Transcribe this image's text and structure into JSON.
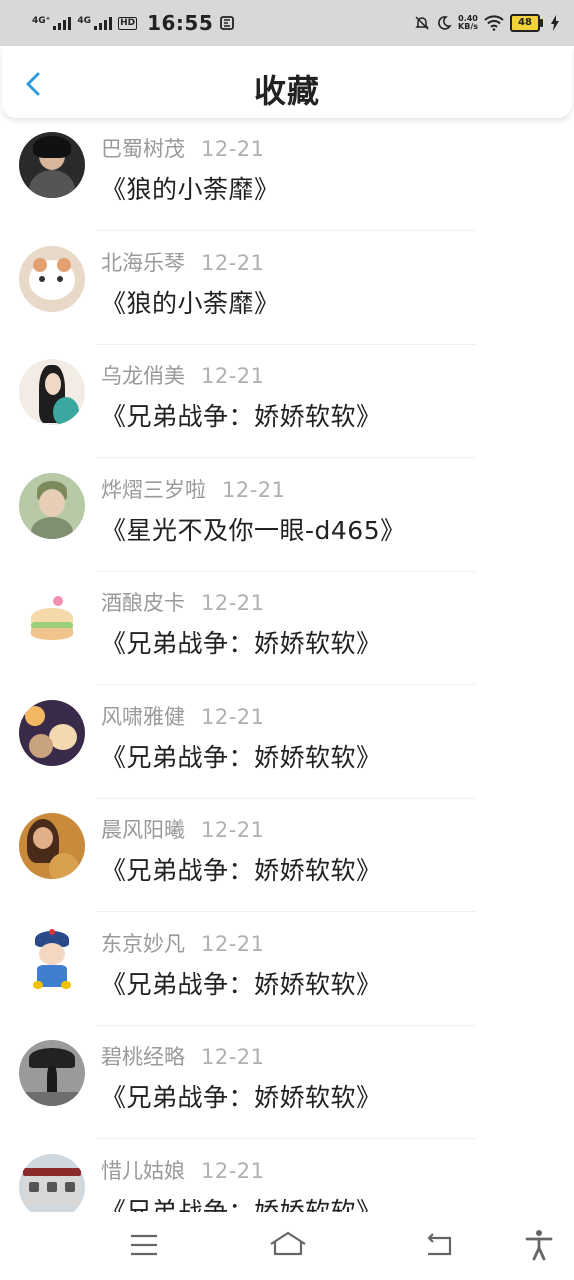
{
  "status_bar": {
    "sim1": "4G⁺",
    "sim2": "4G",
    "hd": "HD",
    "time": "16:55",
    "net_speed_value": "0.40",
    "net_speed_unit": "KB/s",
    "battery": "48",
    "icons": [
      "signal-icon",
      "signal-icon",
      "hd-icon",
      "notification-icon",
      "mute-icon",
      "moon-icon",
      "wifi-icon",
      "battery-icon",
      "charging-icon"
    ]
  },
  "header": {
    "title": "收藏",
    "back_icon": "chevron-left-icon"
  },
  "favorites": [
    {
      "user": "巴蜀树茂",
      "date": "12-21",
      "book": "《狼的小荼靡》"
    },
    {
      "user": "北海乐琴",
      "date": "12-21",
      "book": "《狼的小荼靡》"
    },
    {
      "user": "乌龙俏美",
      "date": "12-21",
      "book": "《兄弟战争：娇娇软软》"
    },
    {
      "user": "烨熠三岁啦",
      "date": "12-21",
      "book": "《星光不及你一眼-d465》"
    },
    {
      "user": "酒酿皮卡",
      "date": "12-21",
      "book": "《兄弟战争：娇娇软软》"
    },
    {
      "user": "风啸雅健",
      "date": "12-21",
      "book": "《兄弟战争：娇娇软软》"
    },
    {
      "user": "晨风阳曦",
      "date": "12-21",
      "book": "《兄弟战争：娇娇软软》"
    },
    {
      "user": "东京妙凡",
      "date": "12-21",
      "book": "《兄弟战争：娇娇软软》"
    },
    {
      "user": "碧桃经略",
      "date": "12-21",
      "book": "《兄弟战争：娇娇软软》"
    },
    {
      "user": "惜儿姑娘",
      "date": "12-21",
      "book": "《兄弟战争：娇娇软软》"
    }
  ],
  "nav_bar": {
    "icons": [
      "menu-icon",
      "home-icon",
      "back-icon",
      "accessibility-icon"
    ]
  },
  "colors": {
    "accent": "#2f9be0",
    "status_bar_bg": "#d8d8d8",
    "username": "#9a9a9a",
    "date": "#b0b0b0",
    "text": "#222222"
  }
}
